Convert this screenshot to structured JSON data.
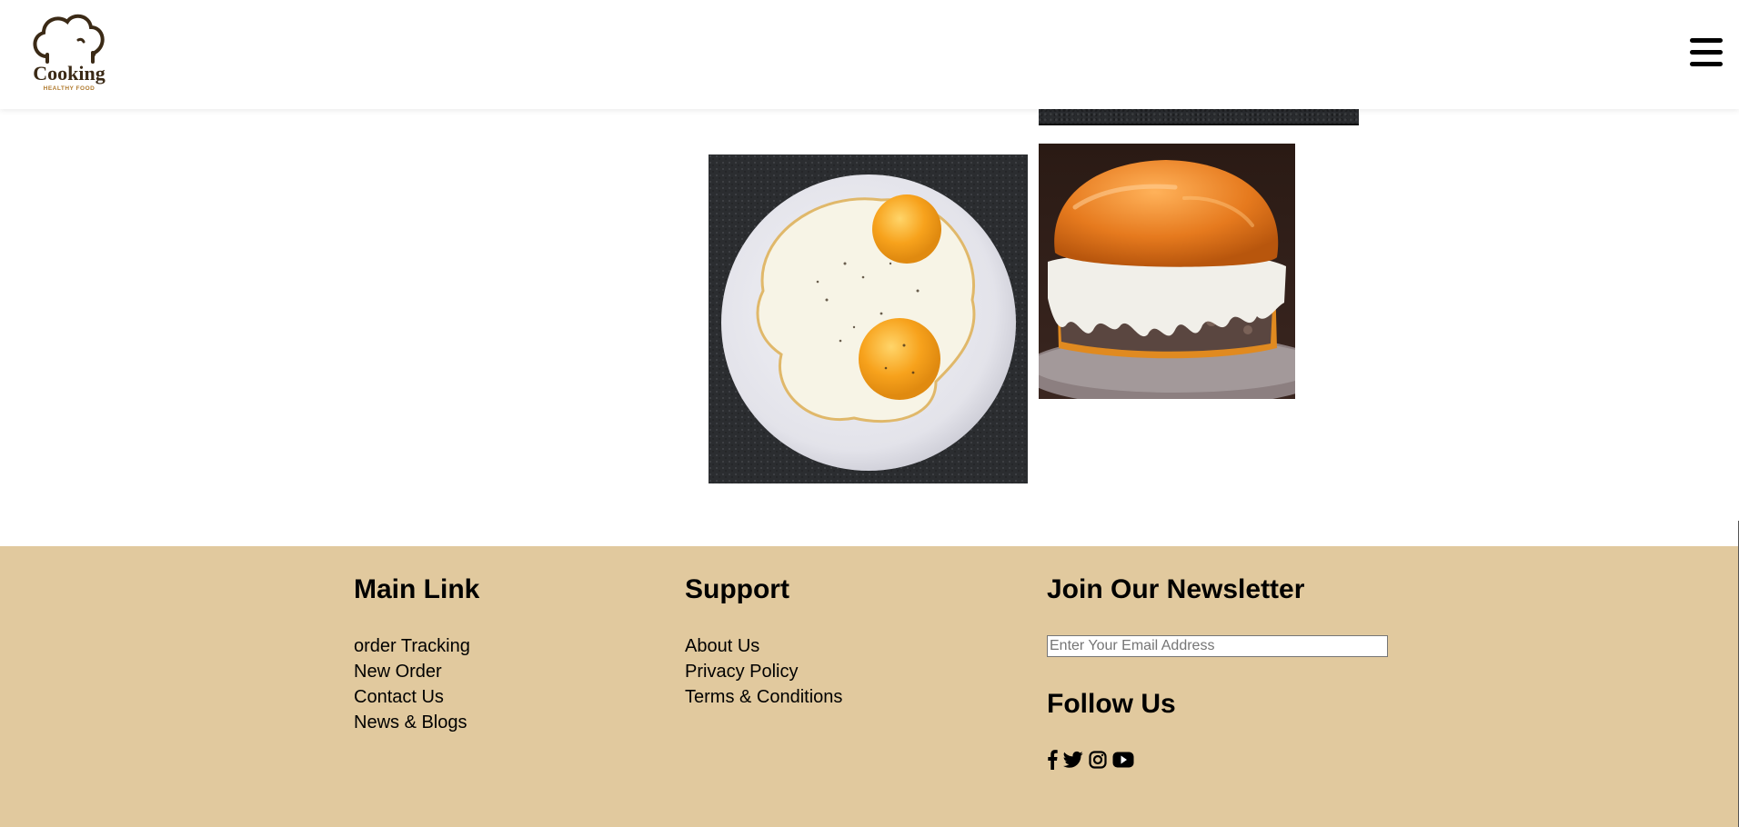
{
  "header": {
    "logo": {
      "icon": "chef-hat-icon",
      "title": "Cooking",
      "tagline": "HEALTHY FOOD",
      "brand_color": "#3b2a16",
      "tagline_color": "#b07a2e"
    },
    "menu_icon": "hamburger-menu-icon"
  },
  "gallery": {
    "images": [
      {
        "name": "dark-stone-image-partial"
      },
      {
        "name": "fried-eggs-image"
      },
      {
        "name": "burger-with-gravy-image"
      }
    ]
  },
  "footer": {
    "background": "#e1c99e",
    "main_link": {
      "title": "Main Link",
      "items": [
        "order Tracking",
        "New Order",
        "Contact Us",
        "News & Blogs"
      ]
    },
    "support": {
      "title": "Support",
      "items": [
        "About Us",
        "Privacy Policy",
        "Terms & Conditions"
      ]
    },
    "newsletter": {
      "title": "Join Our Newsletter",
      "email_placeholder": "Enter Your Email Address",
      "email_value": ""
    },
    "follow": {
      "title": "Follow Us",
      "icons": [
        "facebook-icon",
        "twitter-icon",
        "instagram-icon",
        "youtube-icon"
      ]
    }
  }
}
